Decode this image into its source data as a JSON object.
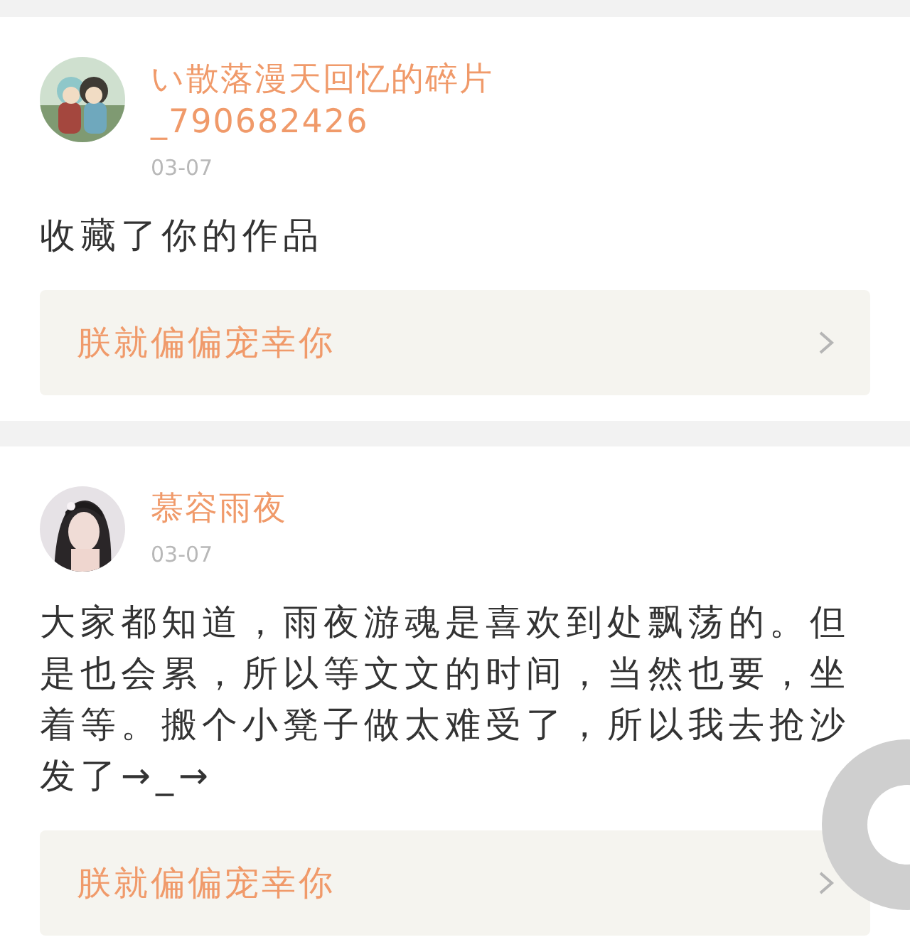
{
  "posts": [
    {
      "name": "い散落漫天回忆的碎片",
      "handle": "_790682426",
      "date": "03-07",
      "content": "收藏了你的作品",
      "linked_work": "朕就偏偏宠幸你"
    },
    {
      "name": "慕容雨夜",
      "date": "03-07",
      "content": "大家都知道，雨夜游魂是喜欢到处飘荡的。但是也会累，所以等文文的时间，当然也要，坐着等。搬个小凳子做太难受了，所以我去抢沙发了→_→",
      "linked_work": "朕就偏偏宠幸你"
    }
  ],
  "floating_button": {
    "kind": "assistive"
  }
}
